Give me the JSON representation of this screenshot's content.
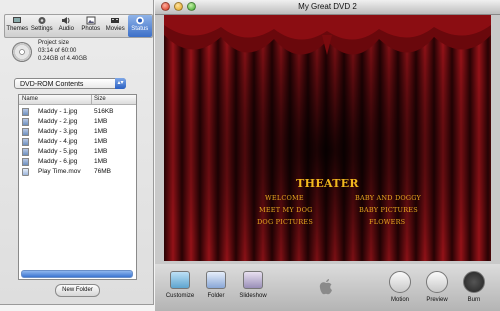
{
  "drawer": {
    "tabs": [
      {
        "label": "Themes",
        "icon": "themes-icon"
      },
      {
        "label": "Settings",
        "icon": "settings-gear-icon"
      },
      {
        "label": "Audio",
        "icon": "speaker-icon"
      },
      {
        "label": "Photos",
        "icon": "photo-icon"
      },
      {
        "label": "Movies",
        "icon": "film-icon"
      },
      {
        "label": "Status",
        "icon": "status-icon",
        "active": true
      }
    ],
    "project_size": {
      "label": "Project size",
      "time": "03:14 of 60:00",
      "capacity": "0.24GB of 4.40GB"
    },
    "dropdown": {
      "selected": "DVD-ROM Contents"
    },
    "list": {
      "columns": [
        "Name",
        "Size"
      ],
      "rows": [
        {
          "name": "Maddy - 1.jpg",
          "size": "516KB",
          "type": "jpg"
        },
        {
          "name": "Maddy - 2.jpg",
          "size": "1MB",
          "type": "jpg"
        },
        {
          "name": "Maddy - 3.jpg",
          "size": "1MB",
          "type": "jpg"
        },
        {
          "name": "Maddy - 4.jpg",
          "size": "1MB",
          "type": "jpg"
        },
        {
          "name": "Maddy - 5.jpg",
          "size": "1MB",
          "type": "jpg"
        },
        {
          "name": "Maddy - 6.jpg",
          "size": "1MB",
          "type": "jpg"
        },
        {
          "name": "Play Time.mov",
          "size": "76MB",
          "type": "mov"
        }
      ]
    },
    "new_folder_label": "New Folder"
  },
  "window": {
    "title": "My Great DVD 2",
    "menu": {
      "title": "THEATER",
      "items_left": [
        "WELCOME",
        "MEET MY DOG",
        "DOG PICTURES"
      ],
      "items_right": [
        "BABY AND DOGGY",
        "BABY PICTURES",
        "FLOWERS"
      ]
    },
    "buttons": [
      {
        "label": "Customize",
        "icon": "customize-icon"
      },
      {
        "label": "Folder",
        "icon": "folder-icon"
      },
      {
        "label": "Slideshow",
        "icon": "slideshow-icon"
      },
      {
        "label": "Motion",
        "icon": "motion-walker-icon"
      },
      {
        "label": "Preview",
        "icon": "play-icon"
      },
      {
        "label": "Burn",
        "icon": "burn-icon"
      }
    ]
  },
  "colors": {
    "menu_title": "#f2b81e",
    "menu_item": "#e8a820",
    "curtain": "#8a0c10",
    "selection_blue": "#3b74d1"
  }
}
